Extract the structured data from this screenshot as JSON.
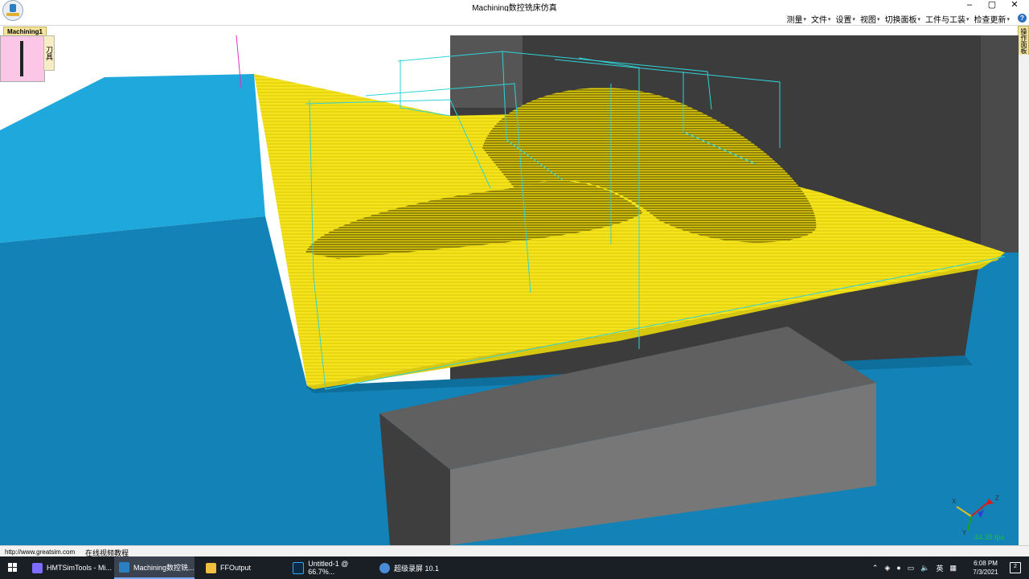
{
  "window": {
    "title": "Machining数控铣床仿真"
  },
  "menu": {
    "items": [
      "测量",
      "文件",
      "设置",
      "视图",
      "切换面板",
      "工件与工装",
      "检查更新"
    ]
  },
  "tabs": {
    "doc": "Machining1",
    "side_panel": "操作面板"
  },
  "tool_panel": {
    "label": "刀具"
  },
  "viewport": {
    "fps": "44.39 fps",
    "axes": {
      "x": "X",
      "y": "Y",
      "z": "Z"
    },
    "colors": {
      "table": "#1493c8",
      "stock": "#f5e41c",
      "wire": "#2fd3d8",
      "bg": "#3a3a3a"
    }
  },
  "status": {
    "url": "http://www.greatsim.com",
    "tutorial": "在线视频教程"
  },
  "taskbar": {
    "apps": [
      {
        "label": "HMTSimTools - Mi...",
        "icon": "infinity-icon"
      },
      {
        "label": "Machining数控铣...",
        "icon": "machining-icon",
        "active": true
      },
      {
        "label": "FFOutput",
        "icon": "folder-icon"
      },
      {
        "label": "Untitled-1 @ 66.7%...",
        "icon": "photoshop-icon"
      },
      {
        "label": "超级录屏 10.1",
        "icon": "recorder-icon"
      }
    ],
    "ime": "英",
    "time": "6:08 PM",
    "date": "7/3/2021",
    "notifications": "2"
  }
}
